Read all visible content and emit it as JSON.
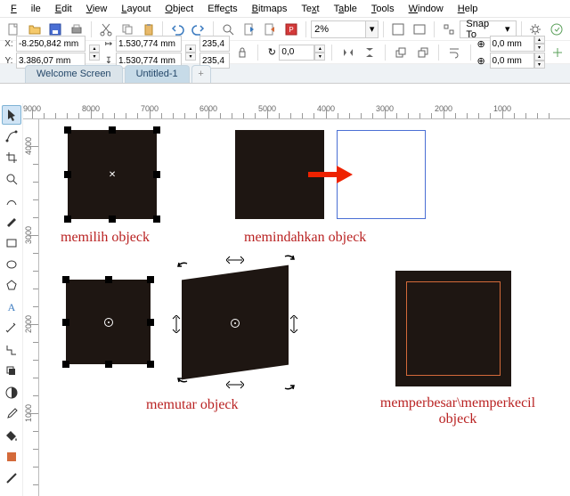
{
  "menu": [
    "File",
    "Edit",
    "View",
    "Layout",
    "Object",
    "Effects",
    "Bitmaps",
    "Text",
    "Table",
    "Tools",
    "Window",
    "Help"
  ],
  "toolbar1": {
    "zoom": "2%",
    "snap": "Snap To"
  },
  "property": {
    "x_label": "X:",
    "y_label": "Y:",
    "x": "-8.250,842 mm",
    "y": "3.386,07 mm",
    "w": "1.530,774 mm",
    "h": "1.530,774 mm",
    "sx": "235,4",
    "sy": "235,4",
    "rot": "0,0",
    "ox": "0,0 mm",
    "oy": "0,0 mm"
  },
  "tabs": {
    "welcome": "Welcome Screen",
    "doc": "Untitled-1",
    "plus": "+"
  },
  "ruler_h": [
    "9000",
    "8000",
    "7000",
    "6000",
    "5000",
    "4000",
    "3000",
    "2000",
    "1000"
  ],
  "ruler_v": [
    "4000",
    "3000",
    "2000",
    "1000"
  ],
  "captions": {
    "select": "memilih objeck",
    "move": "memindahkan objeck",
    "rotate": "memutar objeck",
    "scale1": "memperbesar\\memperkecil",
    "scale2": "objeck"
  }
}
